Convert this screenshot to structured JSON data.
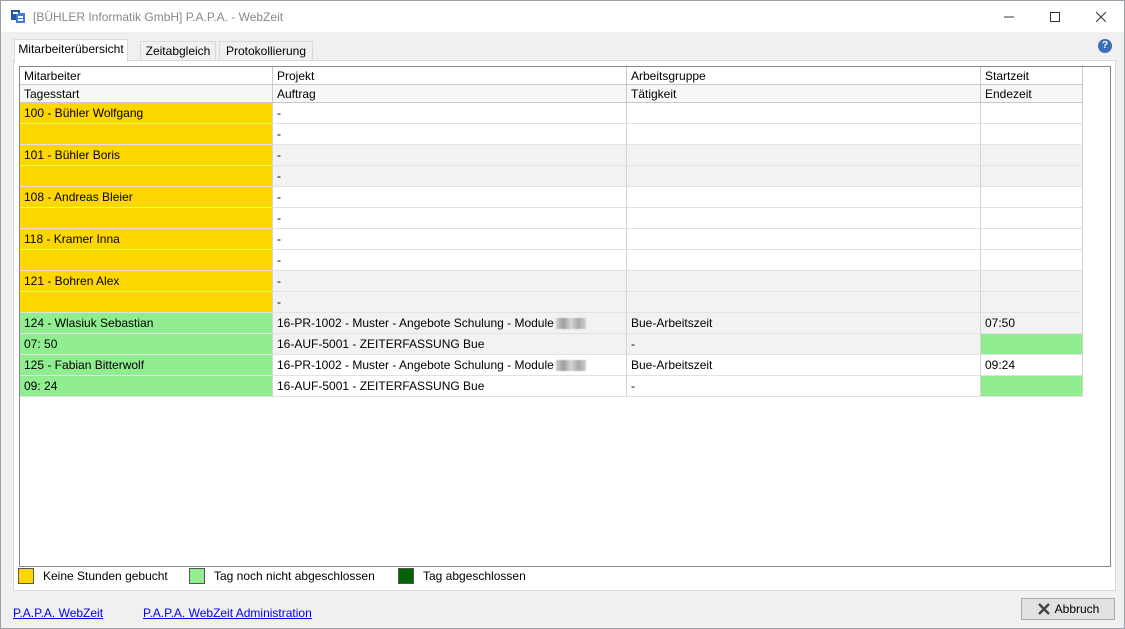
{
  "window": {
    "title": "[BÜHLER Informatik GmbH] P.A.P.A. - WebZeit",
    "minimize_icon": "minimize-icon",
    "maximize_icon": "maximize-icon",
    "close_icon": "close-icon"
  },
  "tabs": [
    {
      "label": "Mitarbeiterübersicht",
      "active": true
    },
    {
      "label": "Zeitabgleich",
      "active": false
    },
    {
      "label": "Protokollierung",
      "active": false
    }
  ],
  "help_icon": "help-icon",
  "table": {
    "header_row1": [
      "Mitarbeiter",
      "Projekt",
      "Arbeitsgruppe",
      "Startzeit"
    ],
    "header_row2": [
      "Tagesstart",
      "Auftrag",
      "Tätigkeit",
      "Endezeit"
    ],
    "rows": [
      {
        "cells": [
          "100 - Bühler Wolfgang",
          "-",
          "",
          ""
        ],
        "status": "yellow",
        "stripe": "white"
      },
      {
        "cells": [
          "",
          "-",
          "",
          ""
        ],
        "status": "yellow",
        "stripe": "white"
      },
      {
        "cells": [
          "101 - Bühler Boris",
          "-",
          "",
          ""
        ],
        "status": "yellow",
        "stripe": "gray"
      },
      {
        "cells": [
          "",
          "-",
          "",
          ""
        ],
        "status": "yellow",
        "stripe": "gray"
      },
      {
        "cells": [
          "108 - Andreas Bleier",
          "-",
          "",
          ""
        ],
        "status": "yellow",
        "stripe": "white"
      },
      {
        "cells": [
          "",
          "-",
          "",
          ""
        ],
        "status": "yellow",
        "stripe": "white"
      },
      {
        "cells": [
          "118 - Kramer Inna",
          "-",
          "",
          ""
        ],
        "status": "yellow",
        "stripe": "white"
      },
      {
        "cells": [
          "",
          "-",
          "",
          ""
        ],
        "status": "yellow",
        "stripe": "white"
      },
      {
        "cells": [
          "121 - Bohren Alex",
          "-",
          "",
          ""
        ],
        "status": "yellow",
        "stripe": "gray"
      },
      {
        "cells": [
          "",
          "-",
          "",
          ""
        ],
        "status": "yellow",
        "stripe": "gray"
      },
      {
        "cells": [
          "124 - Wlasiuk Sebastian",
          "16-PR-1002 - Muster - Angebote Schulung - Module",
          "Bue-Arbeitszeit",
          "07:50"
        ],
        "status": "green",
        "stripe": "gray",
        "blurred": true,
        "end_green": false
      },
      {
        "cells": [
          "07: 50",
          "16-AUF-5001 - ZEITERFASSUNG Bue",
          "-",
          ""
        ],
        "status": "green",
        "stripe": "gray",
        "end_green": true
      },
      {
        "cells": [
          "125 - Fabian Bitterwolf",
          "16-PR-1002 - Muster - Angebote Schulung - Module",
          "Bue-Arbeitszeit",
          "09:24"
        ],
        "status": "green",
        "stripe": "white",
        "blurred": true,
        "end_green": false
      },
      {
        "cells": [
          "09: 24",
          "16-AUF-5001 - ZEITERFASSUNG Bue",
          "-",
          ""
        ],
        "status": "green",
        "stripe": "white",
        "end_green": true
      }
    ]
  },
  "legend": [
    {
      "label": "Keine Stunden gebucht",
      "color": "#ffd700"
    },
    {
      "label": "Tag noch nicht abgeschlossen",
      "color": "#90ee90"
    },
    {
      "label": "Tag abgeschlossen",
      "color": "#006400"
    }
  ],
  "footer": {
    "link1": "P.A.P.A. WebZeit",
    "link2": "P.A.P.A. WebZeit Administration",
    "abort_label": "Abbruch",
    "abort_icon": "close-x-icon"
  }
}
